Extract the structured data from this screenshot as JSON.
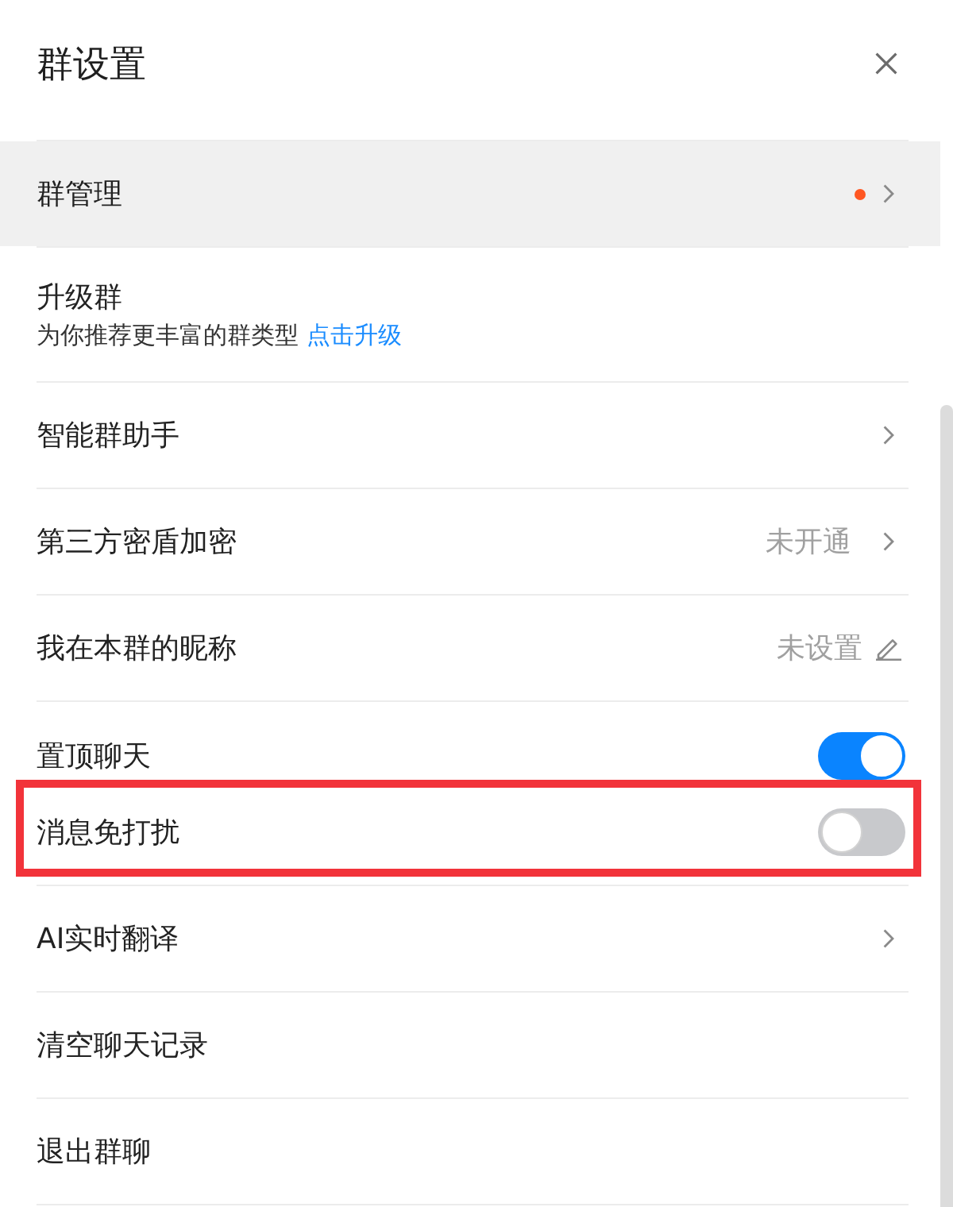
{
  "dialog": {
    "title": "群设置"
  },
  "items": [
    {
      "kind": "nav",
      "label": "群管理",
      "selected": true,
      "notice_dot": true,
      "annotated": false
    },
    {
      "kind": "upgrade",
      "label": "升级群",
      "description": "为你推荐更丰富的群类型",
      "link": "点击升级",
      "selected": false,
      "notice_dot": false,
      "annotated": false
    },
    {
      "kind": "nav",
      "label": "智能群助手",
      "selected": false,
      "notice_dot": false,
      "annotated": false
    },
    {
      "kind": "nav",
      "label": "第三方密盾加密",
      "value": "未开通",
      "selected": false,
      "notice_dot": false,
      "annotated": false
    },
    {
      "kind": "edit",
      "label": "我在本群的昵称",
      "value": "未设置",
      "selected": false,
      "notice_dot": false,
      "annotated": false
    },
    {
      "kind": "toggle",
      "label": "置顶聊天",
      "on": true,
      "selected": false,
      "notice_dot": false,
      "annotated": false
    },
    {
      "kind": "toggle",
      "label": "消息免打扰",
      "on": false,
      "selected": false,
      "notice_dot": false,
      "annotated": true
    },
    {
      "kind": "nav",
      "label": "AI实时翻译",
      "selected": false,
      "notice_dot": false,
      "annotated": false
    },
    {
      "kind": "action",
      "label": "清空聊天记录",
      "selected": false,
      "notice_dot": false,
      "annotated": false
    },
    {
      "kind": "action",
      "label": "退出群聊",
      "selected": false,
      "notice_dot": false,
      "annotated": false
    }
  ]
}
